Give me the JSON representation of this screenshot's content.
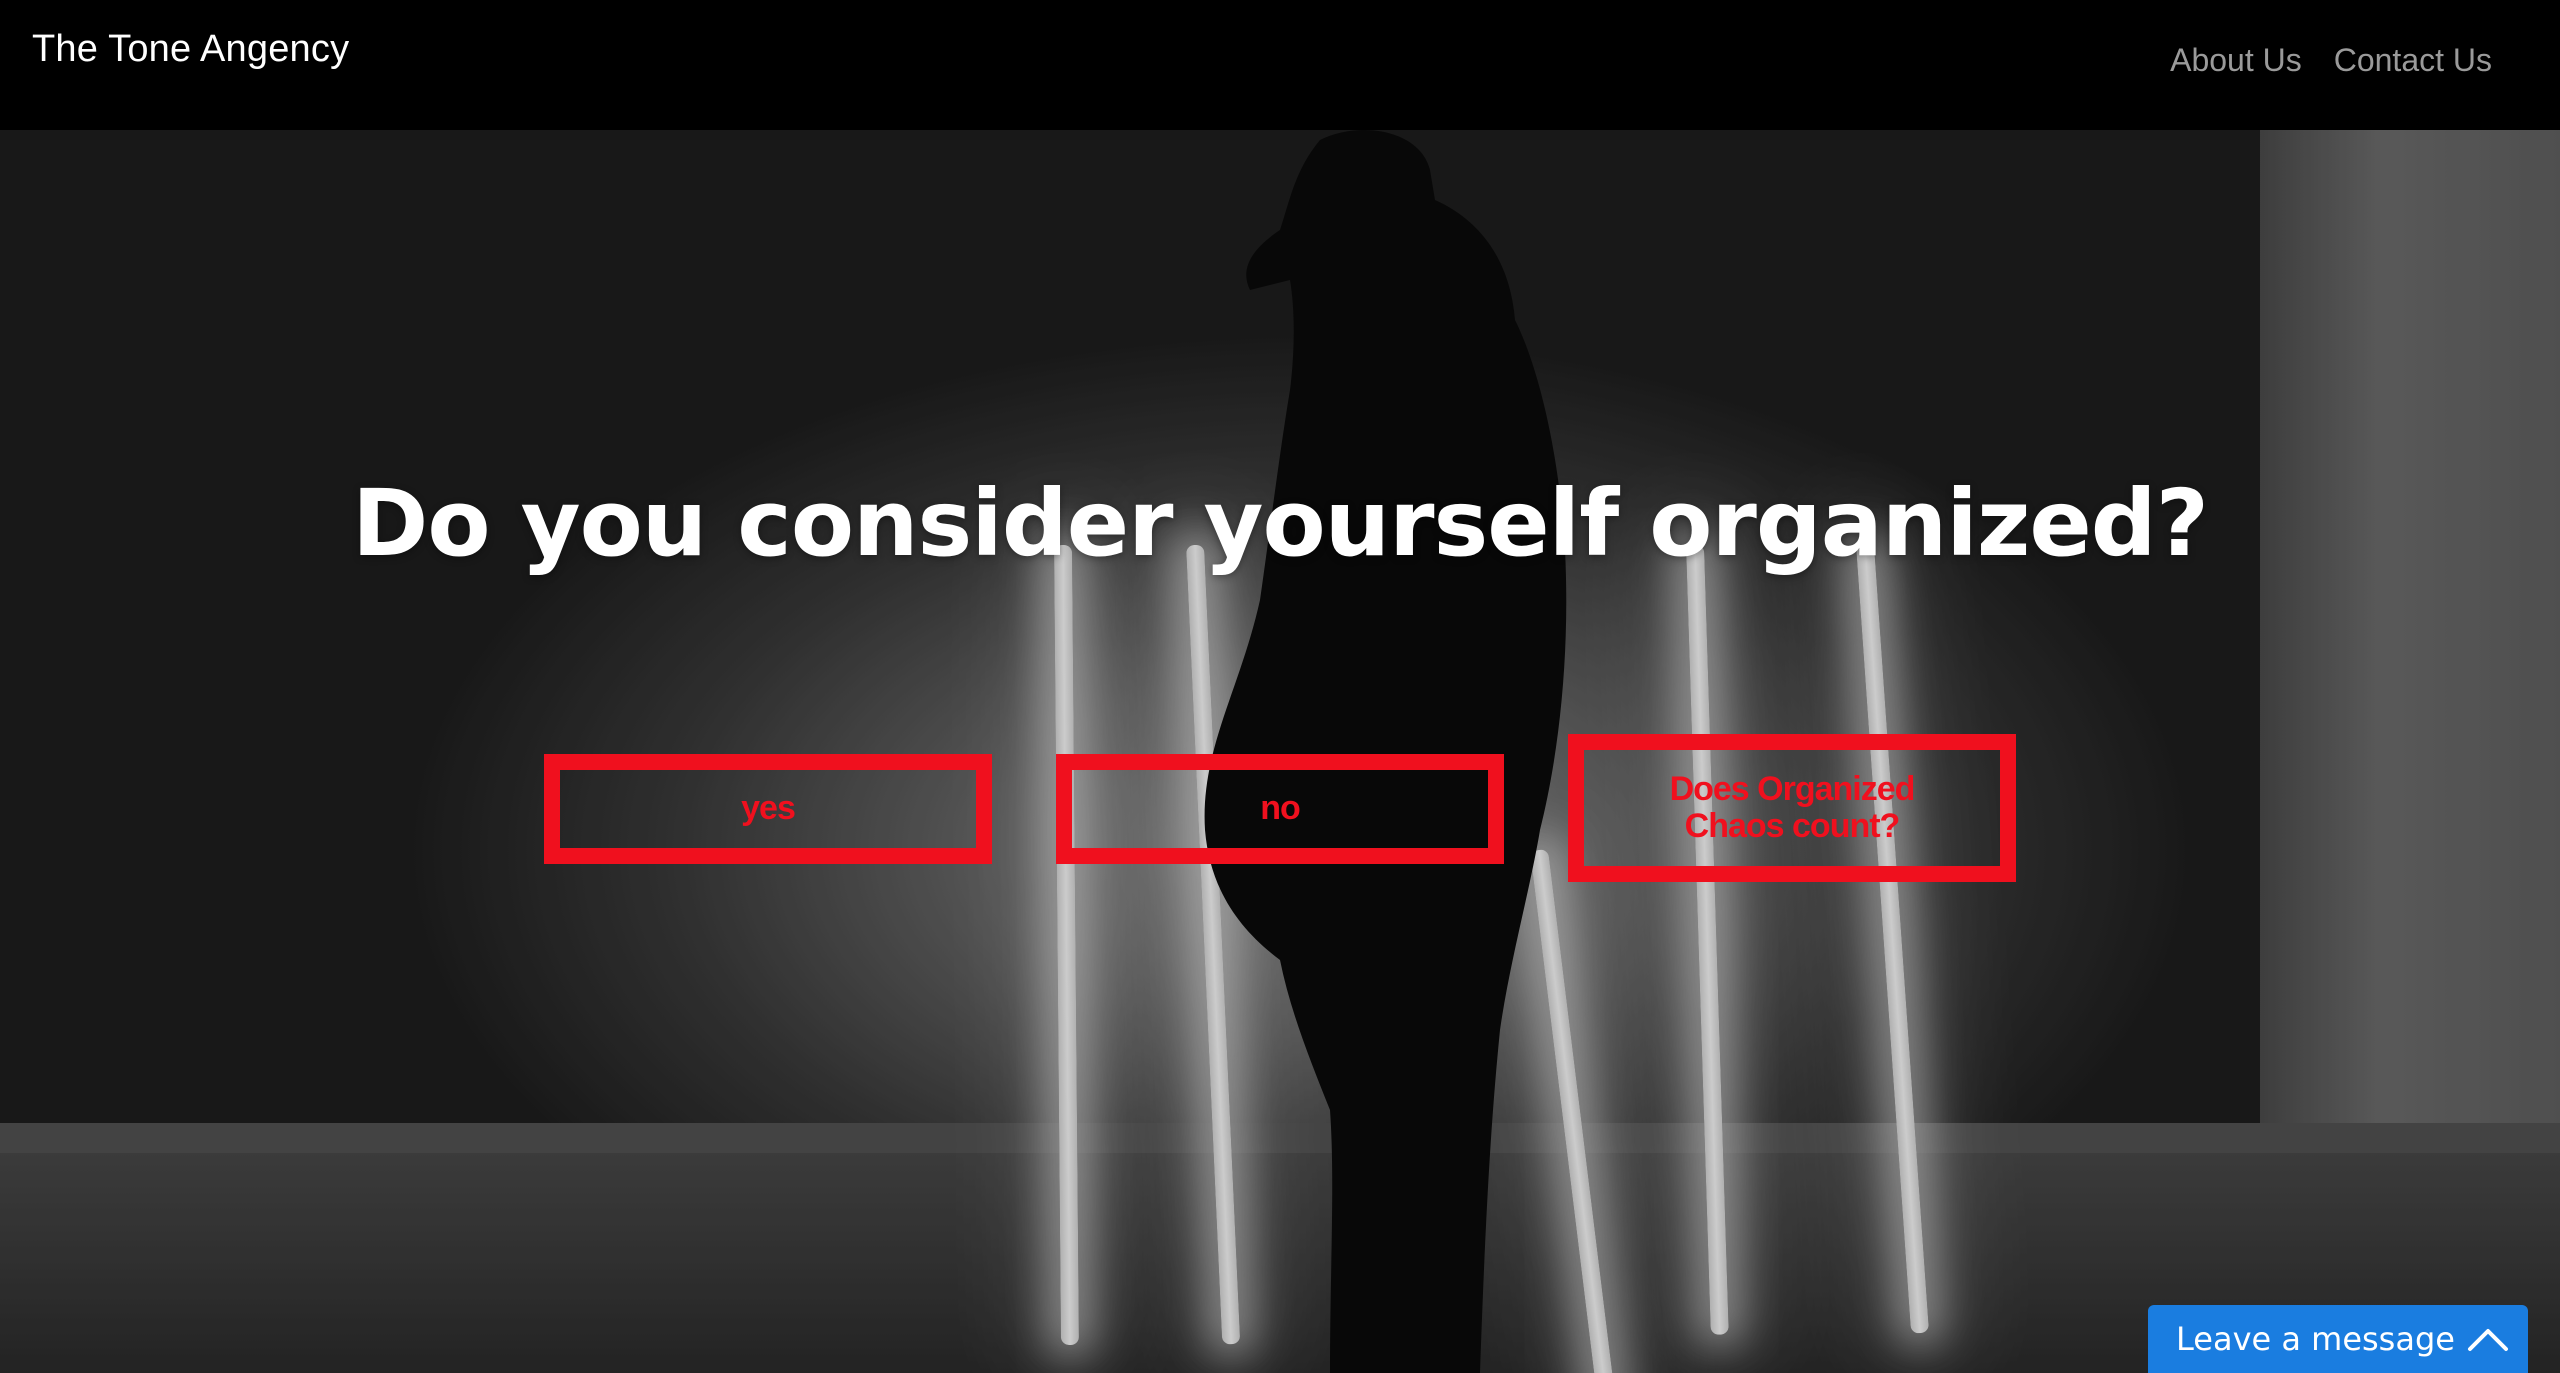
{
  "header": {
    "brand": "The Tone Angency",
    "nav": [
      "About Us",
      "Contact Us"
    ]
  },
  "quiz": {
    "question": "Do you consider yourself organized?",
    "answers": [
      "yes",
      "no",
      "Does Organized Chaos count?"
    ]
  },
  "chat": {
    "label": "Leave a message",
    "icon": "chevron-up-icon"
  },
  "colors": {
    "accent": "#f0101e",
    "chat": "#1a7de0",
    "navbar": "#000000"
  }
}
